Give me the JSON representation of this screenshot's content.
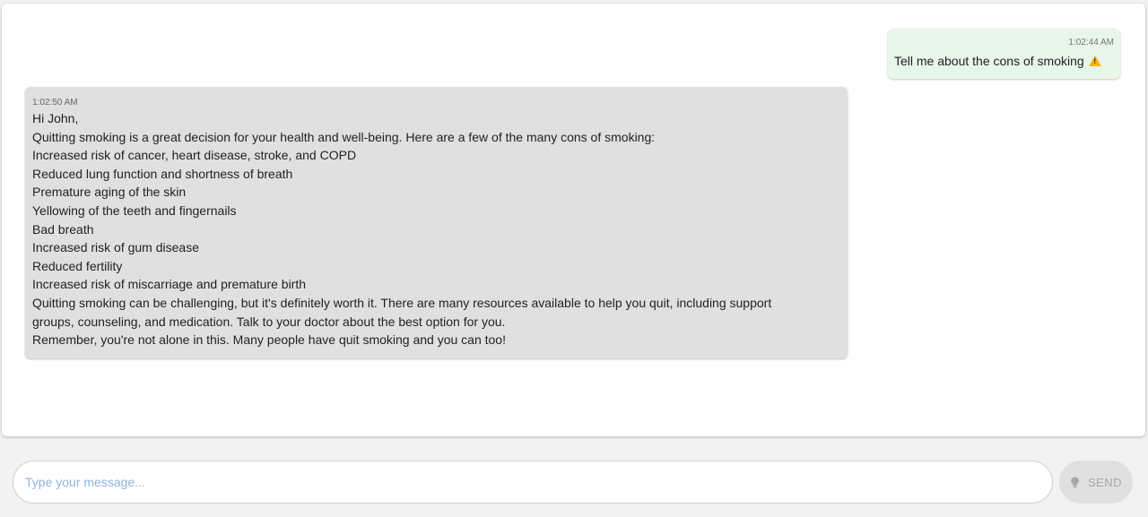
{
  "conversation": {
    "user_message": {
      "time": "1:02:44 AM",
      "text": "Tell me about the cons of smoking",
      "icon": "warning-icon"
    },
    "bot_message": {
      "time": "1:02:50 AM",
      "lines": [
        "Hi John,",
        "Quitting smoking is a great decision for your health and well-being. Here are a few of the many cons of smoking:",
        "Increased risk of cancer, heart disease, stroke, and COPD",
        "Reduced lung function and shortness of breath",
        "Premature aging of the skin",
        "Yellowing of the teeth and fingernails",
        "Bad breath",
        "Increased risk of gum disease",
        "Reduced fertility",
        "Increased risk of miscarriage and premature birth",
        "Quitting smoking can be challenging, but it's definitely worth it. There are many resources available to help you quit, including support",
        "groups, counseling, and medication. Talk to your doctor about the best option for you.",
        "Remember, you're not alone in this. Many people have quit smoking and you can too!"
      ]
    }
  },
  "composer": {
    "placeholder": "Type your message...",
    "value": "",
    "send_label": "SEND",
    "send_icon": "lightbulb-icon"
  },
  "colors": {
    "user_bubble": "#e8f5e9",
    "bot_bubble": "#e0e0e0",
    "placeholder": "#8fb3e0",
    "warning": "#f5b400"
  }
}
